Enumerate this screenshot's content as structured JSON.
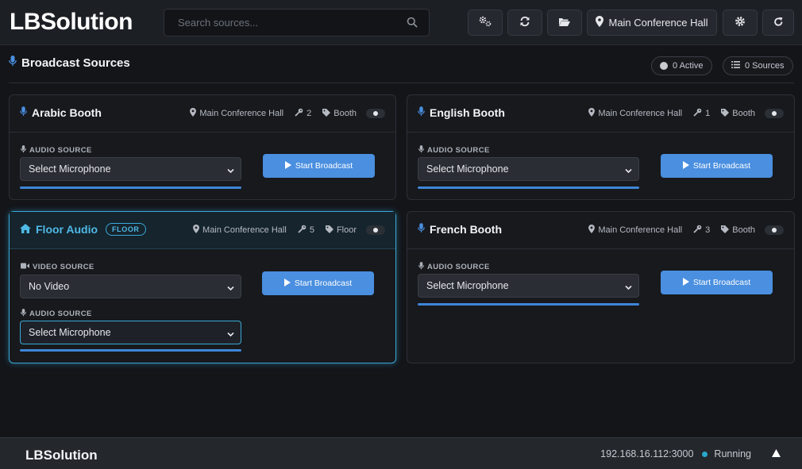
{
  "app": {
    "title": "LBSolution"
  },
  "header": {
    "search_placeholder": "Search sources...",
    "location_label": "Main Conference Hall"
  },
  "section": {
    "title": "Broadcast Sources",
    "active_count": "0 Active",
    "sources_count": "0 Sources"
  },
  "cards": [
    {
      "title": "Arabic Booth",
      "location": "Main Conference Hall",
      "key_number": "2",
      "tag": "Booth",
      "audio_label": "AUDIO SOURCE",
      "audio_value": "Select Microphone",
      "button_label": "Start Broadcast"
    },
    {
      "title": "English Booth",
      "location": "Main Conference Hall",
      "key_number": "1",
      "tag": "Booth",
      "audio_label": "AUDIO SOURCE",
      "audio_value": "Select Microphone",
      "button_label": "Start Broadcast"
    },
    {
      "title": "Floor Audio",
      "badge": "FLOOR",
      "location": "Main Conference Hall",
      "key_number": "5",
      "tag": "Floor",
      "video_label": "VIDEO SOURCE",
      "video_value": "No Video",
      "audio_label": "AUDIO SOURCE",
      "audio_value": "Select Microphone",
      "button_label": "Start Broadcast"
    },
    {
      "title": "French Booth",
      "location": "Main Conference Hall",
      "key_number": "3",
      "tag": "Booth",
      "audio_label": "AUDIO SOURCE",
      "audio_value": "Select Microphone",
      "button_label": "Start Broadcast"
    }
  ],
  "footer": {
    "logo": "LBSolution",
    "address": "192.168.16.112:3000",
    "status": "Running"
  },
  "colors": {
    "accent": "#4a8fe0",
    "active_border": "#3aa8d8",
    "status_running": "#2aa8c9"
  }
}
